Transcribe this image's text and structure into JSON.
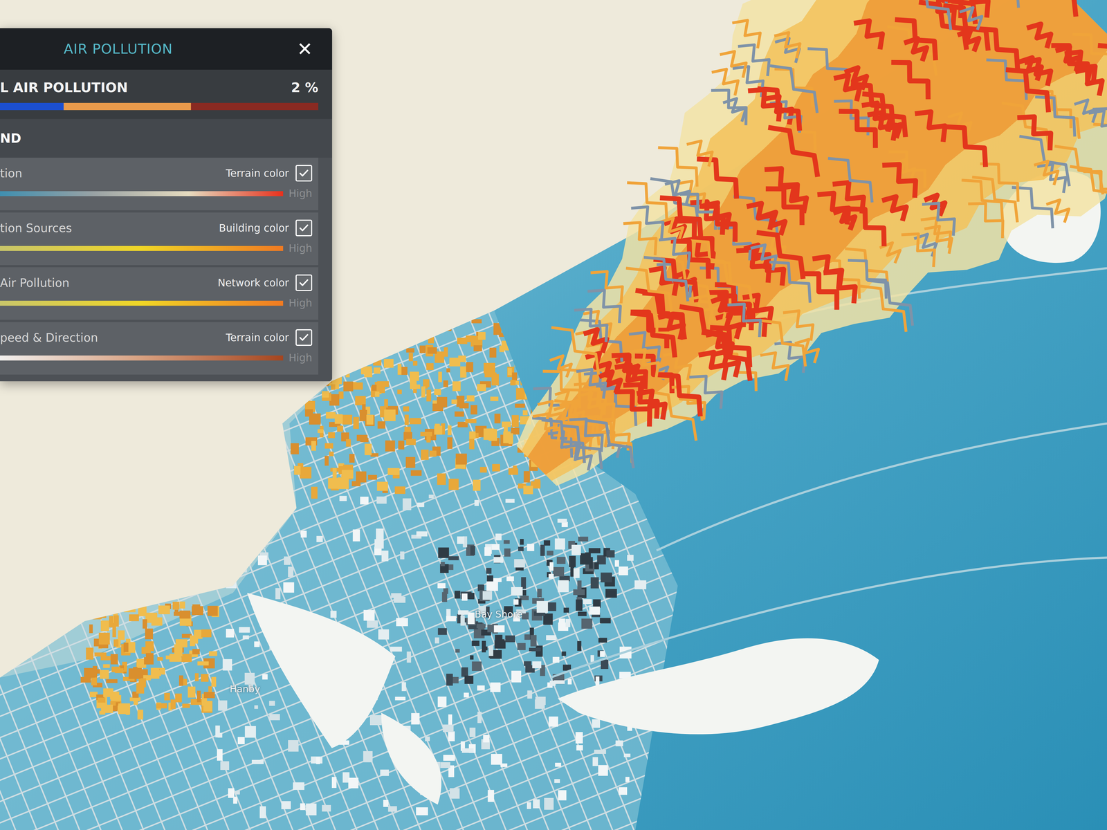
{
  "panel": {
    "title": "AIR POLLUTION",
    "close": "✕"
  },
  "total": {
    "label": "L AIR POLLUTION",
    "value": "2 %"
  },
  "legend": {
    "title": "ND",
    "items": [
      {
        "label": "tion",
        "toggle": "Terrain color",
        "checked": true,
        "high": "High",
        "gradient": [
          "#3f8fb0",
          "#9aa3a5",
          "#e6dcc0",
          "#e8301c"
        ]
      },
      {
        "label": "tion Sources",
        "toggle": "Building color",
        "checked": true,
        "high": "High",
        "gradient": [
          "#c9c66a",
          "#f0d626",
          "#f07a22"
        ]
      },
      {
        "label": "Air Pollution",
        "toggle": "Network color",
        "checked": true,
        "high": "High",
        "gradient": [
          "#c9c66a",
          "#f0d626",
          "#f07a22"
        ]
      },
      {
        "label": "peed & Direction",
        "toggle": "Terrain color",
        "checked": true,
        "high": "High",
        "gradient": [
          "#f2f0ee",
          "#d8a080",
          "#a5451f"
        ]
      }
    ]
  },
  "map": {
    "labels": [
      {
        "text": "Bay Shore"
      },
      {
        "text": "Hanby"
      }
    ]
  }
}
